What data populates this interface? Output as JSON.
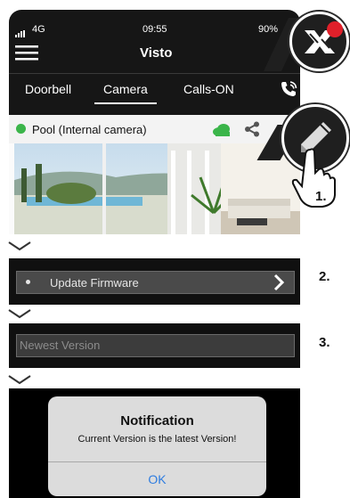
{
  "status_bar": {
    "signal": "4G",
    "time": "09:55",
    "battery": "90%"
  },
  "nav": {
    "title": "Visto",
    "menu_icon": "hamburger-menu-icon"
  },
  "tabs": [
    {
      "label": "Doorbell",
      "active": false
    },
    {
      "label": "Camera",
      "active": true
    },
    {
      "label": "Calls-ON",
      "active": false
    }
  ],
  "call_icon": "phone-wave-icon",
  "camera": {
    "label": "Pool (Internal camera)",
    "status_color": "#3bb54a",
    "cloud_color": "#3bb54a"
  },
  "callouts": {
    "logo_icon": "brand-x-logo-icon",
    "edit_icon": "pencil-icon",
    "notification_color": "#e0202a"
  },
  "steps": {
    "one": "1.",
    "two": "2.",
    "three": "3."
  },
  "update_firmware": {
    "label": "Update Firmware"
  },
  "newest_version": {
    "label": "Newest Version"
  },
  "dialog": {
    "title": "Notification",
    "message": "Current Version is the latest Version!",
    "button": "OK"
  }
}
